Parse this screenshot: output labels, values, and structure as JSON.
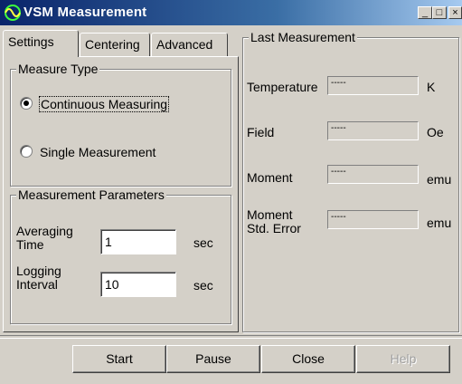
{
  "window": {
    "title": "VSM Measurement",
    "icon": "vsm-app-icon",
    "caption_buttons": {
      "minimize": "_",
      "maximize": "□",
      "close": "×"
    }
  },
  "tabs": [
    {
      "label": "Settings",
      "active": true
    },
    {
      "label": "Centering",
      "active": false
    },
    {
      "label": "Advanced",
      "active": false
    }
  ],
  "measure_type": {
    "title": "Measure Type",
    "options": [
      {
        "label": "Continuous Measuring",
        "selected": true
      },
      {
        "label": "Single Measurement",
        "selected": false
      }
    ]
  },
  "params": {
    "title": "Measurement Parameters",
    "averaging": {
      "label_line1": "Averaging",
      "label_line2": "Time",
      "value": "1",
      "unit": "sec"
    },
    "logging": {
      "label_line1": "Logging",
      "label_line2": "Interval",
      "value": "10",
      "unit": "sec"
    }
  },
  "last_measurement": {
    "title": "Last Measurement",
    "rows": [
      {
        "label": "Temperature",
        "label2": "",
        "value": "-----",
        "unit": "K"
      },
      {
        "label": "Field",
        "label2": "",
        "value": "-----",
        "unit": "Oe"
      },
      {
        "label": "Moment",
        "label2": "",
        "value": "-----",
        "unit": "emu"
      },
      {
        "label": "Moment",
        "label2": "Std. Error",
        "value": "-----",
        "unit": "emu"
      }
    ]
  },
  "buttons": {
    "start": "Start",
    "pause": "Pause",
    "close": "Close",
    "help": "Help"
  }
}
